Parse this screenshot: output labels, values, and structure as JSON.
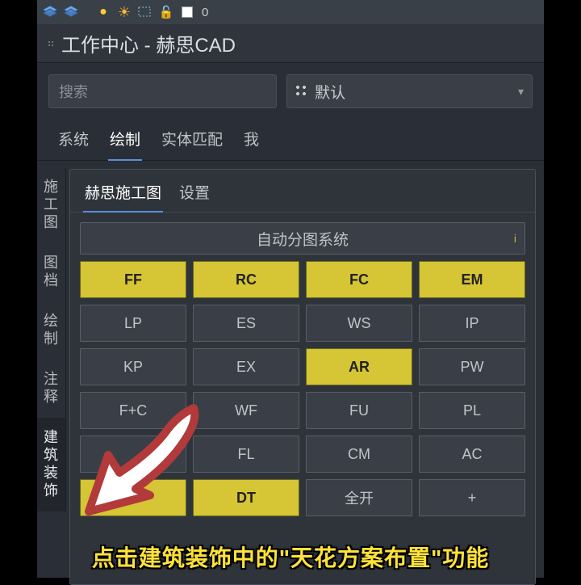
{
  "toolbar": {
    "zero": "0"
  },
  "title": "工作中心 - 赫思CAD",
  "search": {
    "placeholder": "搜索"
  },
  "dropdown": {
    "label": "默认"
  },
  "main_tabs": [
    "系统",
    "绘制",
    "实体匹配",
    "我"
  ],
  "main_active": 1,
  "side_tabs": [
    "施工图",
    "图档",
    "绘制",
    "注释",
    "建筑装饰"
  ],
  "side_active": 4,
  "panel_tabs": [
    "赫思施工图",
    "设置"
  ],
  "panel_active": 0,
  "auto_label": "自动分图系统",
  "grid": [
    [
      {
        "t": "FF",
        "y": true
      },
      {
        "t": "RC",
        "y": true
      },
      {
        "t": "FC",
        "y": true
      },
      {
        "t": "EM",
        "y": true
      }
    ],
    [
      {
        "t": "LP"
      },
      {
        "t": "ES"
      },
      {
        "t": "WS"
      },
      {
        "t": "IP"
      }
    ],
    [
      {
        "t": "KP"
      },
      {
        "t": "EX"
      },
      {
        "t": "AR",
        "y": true
      },
      {
        "t": "PW"
      }
    ],
    [
      {
        "t": "F+C"
      },
      {
        "t": "WF"
      },
      {
        "t": "FU"
      },
      {
        "t": "PL"
      }
    ],
    [
      {
        "t": ""
      },
      {
        "t": "FL"
      },
      {
        "t": "CM"
      },
      {
        "t": "AC"
      }
    ],
    [
      {
        "t": "L",
        "y": true
      },
      {
        "t": "DT",
        "y": true
      },
      {
        "t": "全开"
      },
      {
        "t": "+"
      }
    ]
  ],
  "caption": "点击建筑装饰中的\"天花方案布置\"功能"
}
